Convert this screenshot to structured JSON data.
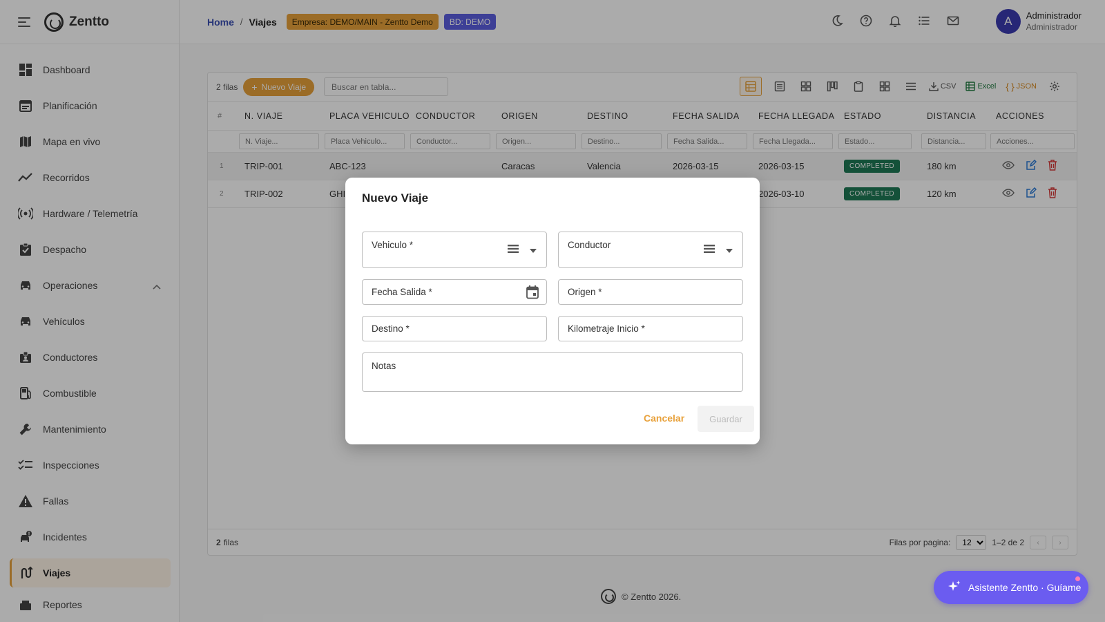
{
  "app": {
    "name": "Zentto"
  },
  "sidebar": {
    "items": [
      {
        "label": "Dashboard",
        "icon": "dashboard-icon"
      },
      {
        "label": "Planificación",
        "icon": "calendar-icon"
      },
      {
        "label": "Mapa en vivo",
        "icon": "map-icon"
      },
      {
        "label": "Recorridos",
        "icon": "timeline-icon"
      },
      {
        "label": "Hardware / Telemetría",
        "icon": "sensors-icon"
      },
      {
        "label": "Despacho",
        "icon": "assignment-icon"
      },
      {
        "label": "Operaciones",
        "icon": "car-icon"
      },
      {
        "label": "Vehículos",
        "icon": "car-icon"
      },
      {
        "label": "Conductores",
        "icon": "badge-icon"
      },
      {
        "label": "Combustible",
        "icon": "fuel-icon"
      },
      {
        "label": "Mantenimiento",
        "icon": "wrench-icon"
      },
      {
        "label": "Inspecciones",
        "icon": "checklist-icon"
      },
      {
        "label": "Fallas",
        "icon": "warning-icon"
      },
      {
        "label": "Incidentes",
        "icon": "incident-icon"
      },
      {
        "label": "Viajes",
        "icon": "route-icon"
      },
      {
        "label": "Reportes",
        "icon": "reports-icon"
      }
    ]
  },
  "topbar": {
    "home": "Home",
    "separator": "/",
    "current": "Viajes",
    "company_chip": "Empresa: DEMO/MAIN - Zentto Demo",
    "db_chip": "BD: DEMO",
    "user_initial": "A",
    "user_name": "Administrador",
    "user_role": "Administrador"
  },
  "table": {
    "rows_count": "2 filas",
    "new_button": "Nuevo Viaje",
    "search_placeholder": "Buscar en tabla...",
    "csv_label": "CSV",
    "excel_label": "Excel",
    "json_label": "JSON",
    "hash_header": "#",
    "columns": [
      "N. VIAJE",
      "PLACA VEHICULO",
      "CONDUCTOR",
      "ORIGEN",
      "DESTINO",
      "FECHA SALIDA",
      "FECHA LLEGADA",
      "ESTADO",
      "DISTANCIA",
      "ACCIONES"
    ],
    "filters": [
      "N. Viaje...",
      "Placa Vehiculo...",
      "Conductor...",
      "Origen...",
      "Destino...",
      "Fecha Salida...",
      "Fecha Llegada...",
      "Estado...",
      "Distancia...",
      "Acciones..."
    ],
    "rows": [
      {
        "idx": "1",
        "trip": "TRIP-001",
        "plate": "ABC-123",
        "driver": "",
        "origin": "Caracas",
        "dest": "Valencia",
        "depart": "2026-03-15",
        "arrive": "2026-03-15",
        "status": "COMPLETED",
        "distance": "180 km"
      },
      {
        "idx": "2",
        "trip": "TRIP-002",
        "plate": "GHI",
        "driver": "",
        "origin": "",
        "dest": "",
        "depart": "",
        "arrive": "2026-03-10",
        "status": "COMPLETED",
        "distance": "120 km"
      }
    ],
    "footer_count_num": "2",
    "footer_count_word": "filas",
    "per_page_label": "Filas por pagina:",
    "per_page_value": "12",
    "range": "1–2 de 2"
  },
  "footer": {
    "copyright": "© Zentto 2026."
  },
  "assistant": {
    "label": "Asistente Zentto · Guíame"
  },
  "modal": {
    "title": "Nuevo Viaje",
    "vehicle": "Vehiculo *",
    "driver": "Conductor",
    "depart_date": "Fecha Salida *",
    "origin": "Origen *",
    "destination": "Destino *",
    "km_start": "Kilometraje Inicio *",
    "notes": "Notas",
    "cancel": "Cancelar",
    "save": "Guardar"
  },
  "colors": {
    "accent": "#e8a13b",
    "primary": "#3b4fb4",
    "chip_blue": "#5c5ee0",
    "success": "#1e7a55",
    "danger": "#d63a3a",
    "edit": "#2a7ad6",
    "assistant": "#6b5cf0"
  }
}
